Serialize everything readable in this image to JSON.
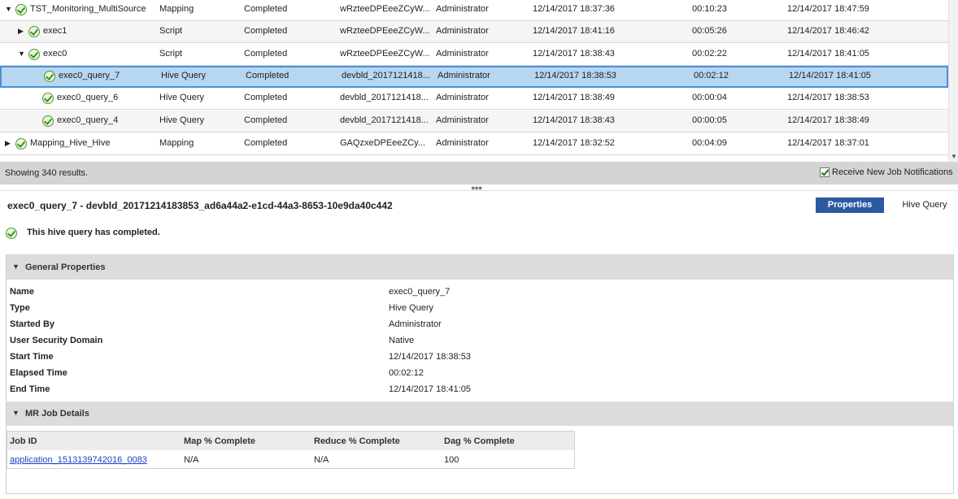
{
  "grid": {
    "rows": [
      {
        "name": "TST_Monitoring_MultiSource",
        "type": "Mapping",
        "status": "Completed",
        "id": "wRzteeDPEeeZCyW...",
        "user": "Administrator",
        "start": "12/14/2017 18:37:36",
        "elapsed": "00:10:23",
        "end": "12/14/2017 18:47:59",
        "expander": "▼",
        "indent": 0
      },
      {
        "name": "exec1",
        "type": "Script",
        "status": "Completed",
        "id": "wRzteeDPEeeZCyW...",
        "user": "Administrator",
        "start": "12/14/2017 18:41:16",
        "elapsed": "00:05:26",
        "end": "12/14/2017 18:46:42",
        "expander": "▶",
        "indent": 1
      },
      {
        "name": "exec0",
        "type": "Script",
        "status": "Completed",
        "id": "wRzteeDPEeeZCyW...",
        "user": "Administrator",
        "start": "12/14/2017 18:38:43",
        "elapsed": "00:02:22",
        "end": "12/14/2017 18:41:05",
        "expander": "▼",
        "indent": 1
      },
      {
        "name": "exec0_query_7",
        "type": "Hive Query",
        "status": "Completed",
        "id": "devbld_2017121418...",
        "user": "Administrator",
        "start": "12/14/2017 18:38:53",
        "elapsed": "00:02:12",
        "end": "12/14/2017 18:41:05",
        "expander": "",
        "indent": 2,
        "selected": true
      },
      {
        "name": "exec0_query_6",
        "type": "Hive Query",
        "status": "Completed",
        "id": "devbld_2017121418...",
        "user": "Administrator",
        "start": "12/14/2017 18:38:49",
        "elapsed": "00:00:04",
        "end": "12/14/2017 18:38:53",
        "expander": "",
        "indent": 2
      },
      {
        "name": "exec0_query_4",
        "type": "Hive Query",
        "status": "Completed",
        "id": "devbld_2017121418...",
        "user": "Administrator",
        "start": "12/14/2017 18:38:43",
        "elapsed": "00:00:05",
        "end": "12/14/2017 18:38:49",
        "expander": "",
        "indent": 2
      },
      {
        "name": "Mapping_Hive_Hive",
        "type": "Mapping",
        "status": "Completed",
        "id": "GAQzxeDPEeeZCy...",
        "user": "Administrator",
        "start": "12/14/2017 18:32:52",
        "elapsed": "00:04:09",
        "end": "12/14/2017 18:37:01",
        "expander": "▶",
        "indent": 0
      }
    ]
  },
  "status": {
    "showing": "Showing 340 results.",
    "notifications_label": "Receive New Job Notifications",
    "notifications_checked": true
  },
  "detail": {
    "title": "exec0_query_7 - devbld_20171214183853_ad6a44a2-e1cd-44a3-8653-10e9da40c442",
    "tabs": {
      "properties": "Properties",
      "hive_query": "Hive Query"
    },
    "message": "This hive query has completed."
  },
  "general": {
    "heading": "General Properties",
    "props": [
      {
        "name": "Name",
        "value": "exec0_query_7"
      },
      {
        "name": "Type",
        "value": "Hive Query"
      },
      {
        "name": "Started By",
        "value": "Administrator"
      },
      {
        "name": "User Security Domain",
        "value": "Native"
      },
      {
        "name": "Start Time",
        "value": "12/14/2017 18:38:53"
      },
      {
        "name": "Elapsed Time",
        "value": "00:02:12"
      },
      {
        "name": "End Time",
        "value": "12/14/2017 18:41:05"
      }
    ]
  },
  "mr": {
    "heading": "MR Job Details",
    "columns": [
      "Job ID",
      "Map % Complete",
      "Reduce % Complete",
      "Dag % Complete"
    ],
    "row": {
      "job_id": "application_1513139742016_0083",
      "map": "N/A",
      "reduce": "N/A",
      "dag": "100"
    }
  },
  "icons": {
    "expand": "chevron-icon",
    "status": "check-circle-icon"
  },
  "colors": {
    "selected_row": "#b6d6f2",
    "accent": "#2c5aa0",
    "success": "#4a9b2a",
    "link": "#1a3fc7"
  }
}
